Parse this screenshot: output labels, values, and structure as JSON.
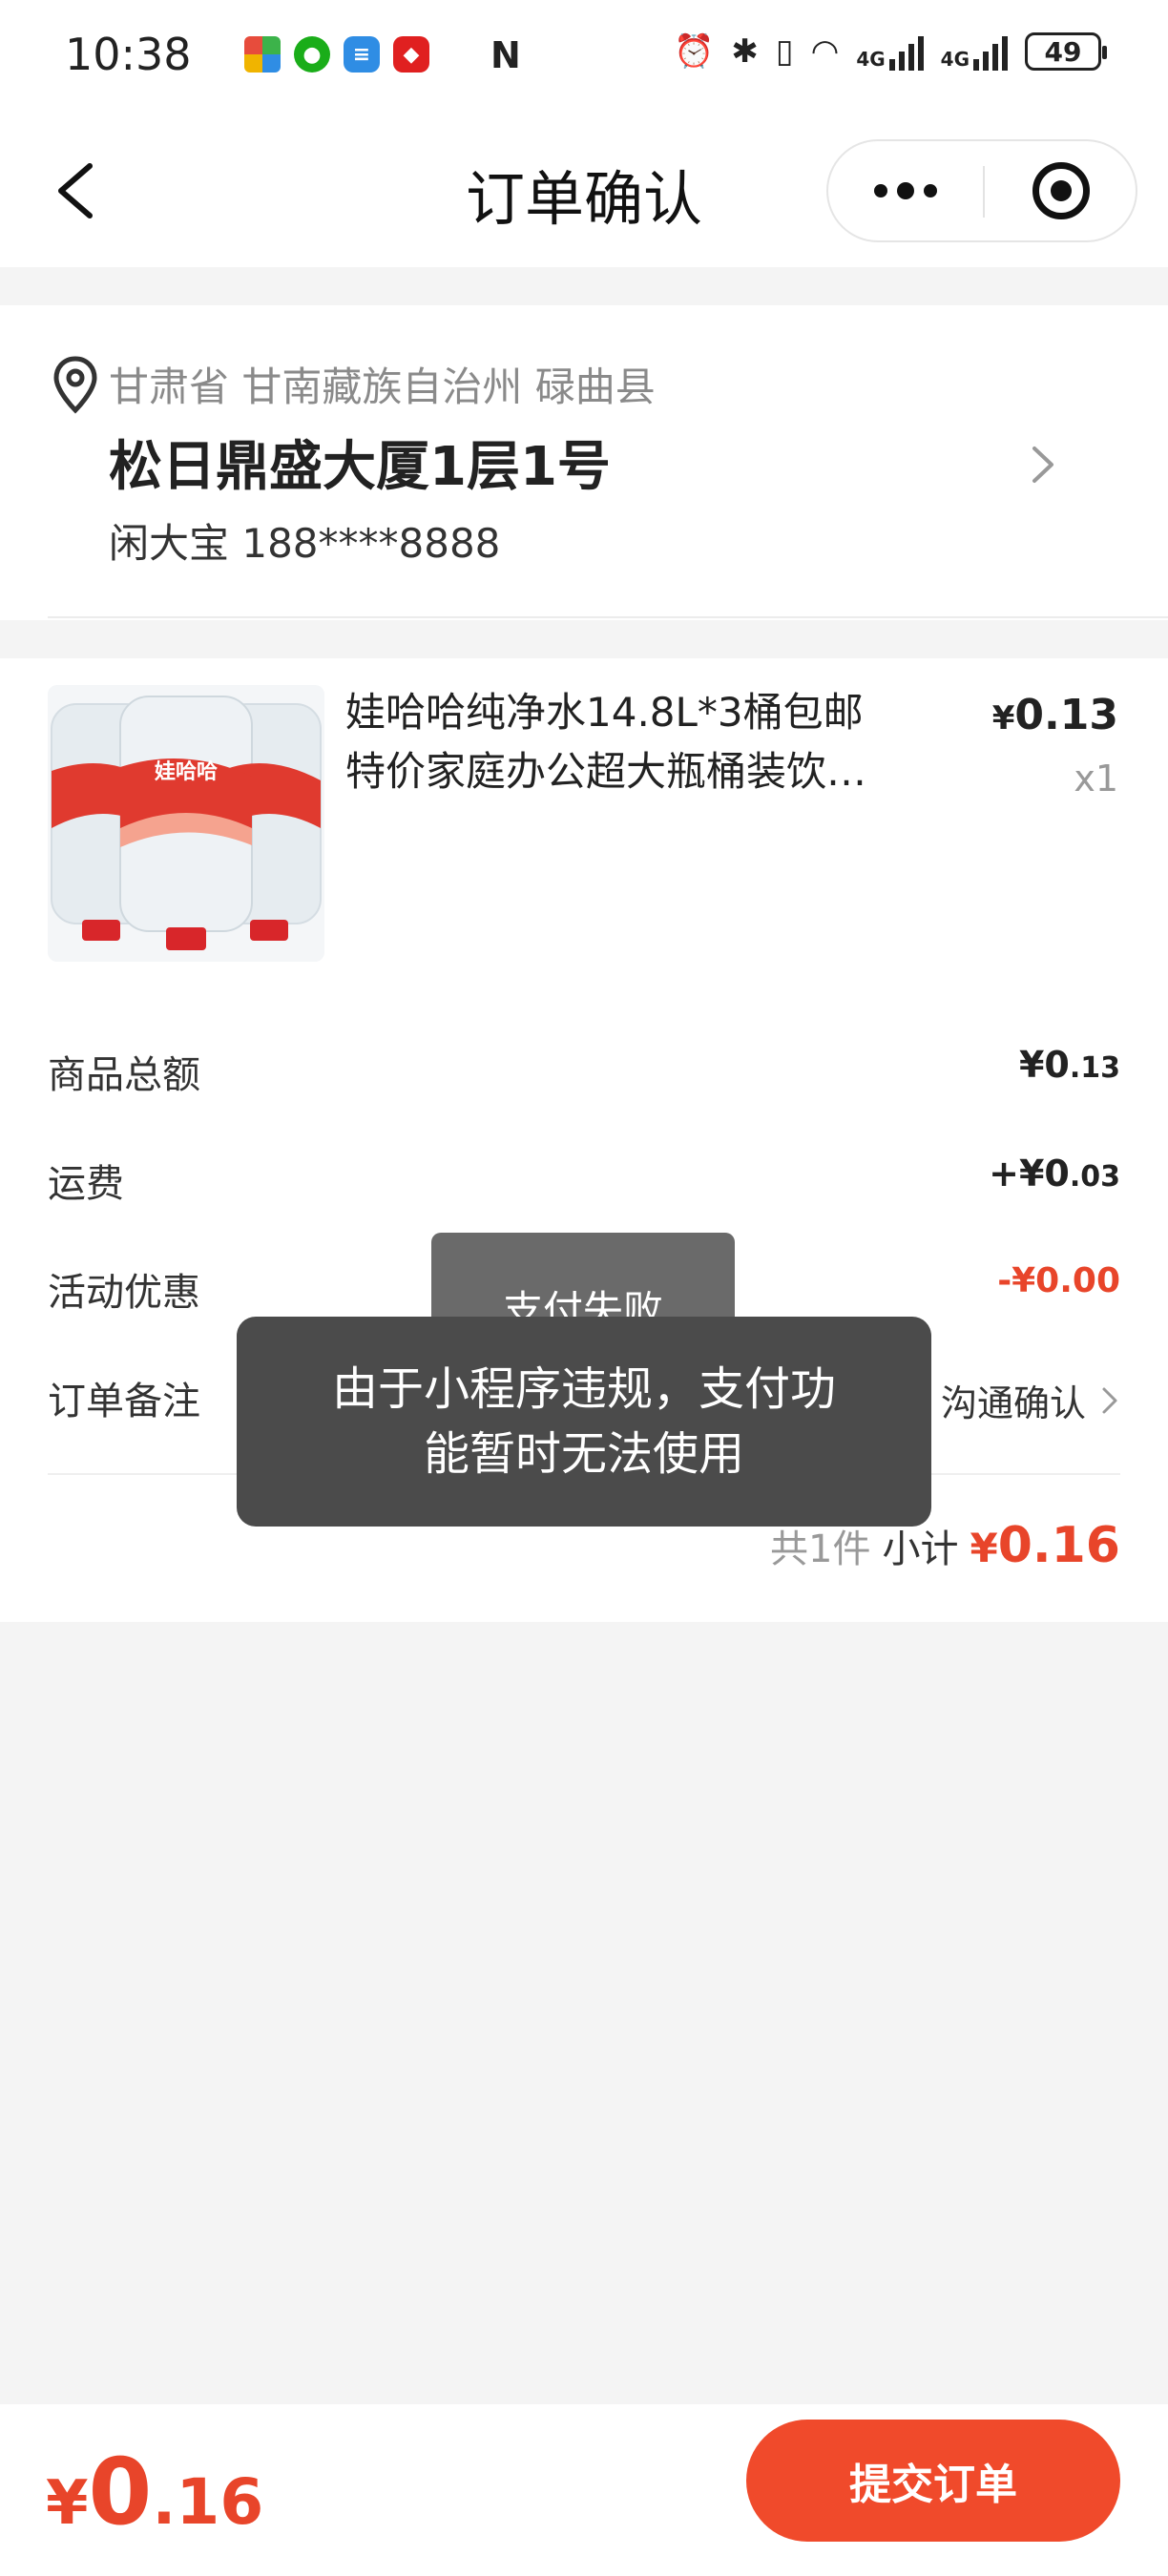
{
  "status_bar": {
    "time": "10:38",
    "net_labels": [
      "4G",
      "4G"
    ],
    "battery": "49",
    "nfc": "N"
  },
  "nav": {
    "title": "订单确认"
  },
  "address": {
    "region": "甘肃省 甘南藏族自治州 碌曲县",
    "detail": "松日鼎盛大厦1层1号",
    "contact": "闲大宝 188****8888"
  },
  "product": {
    "title": "娃哈哈纯净水14.8L*3桶包邮特价家庭办公超大瓶桶装饮…",
    "image_brand": "娃哈哈",
    "price_currency": "¥",
    "price_int": "0",
    "price_dec": ".13",
    "quantity": "x1"
  },
  "summary": {
    "goods_total_label": "商品总额",
    "goods_total_prefix": "¥0",
    "goods_total_dec": ".13",
    "shipping_label": "运费",
    "shipping_prefix": "+¥0",
    "shipping_dec": ".03",
    "discount_label": "活动优惠",
    "discount_value": "-¥0.00",
    "note_label": "订单备注",
    "note_value": "沟通确认",
    "count_text": "共1件",
    "subtotal_label": "小计",
    "subtotal_currency": "¥",
    "subtotal_value": "0.16"
  },
  "toast": {
    "back_text": "支付失败",
    "front_text": "由于小程序违规，支付功能暂时无法使用"
  },
  "bottom": {
    "total_currency": "¥",
    "total_int": "0",
    "total_dec": ".16",
    "submit_label": "提交订单"
  },
  "colors": {
    "accent": "#e8452a",
    "submit_bg": "#f04a2b",
    "page_bg": "#f4f4f4",
    "toast_bg": "#4b4b4b"
  }
}
